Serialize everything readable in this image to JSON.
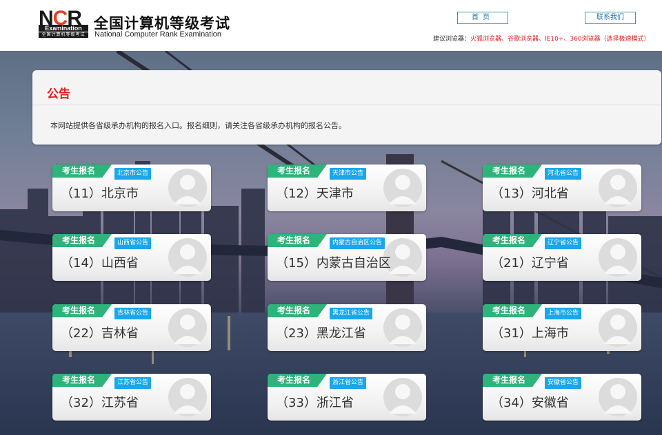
{
  "header": {
    "logo_letters": "NCR",
    "logo_word": "Examination",
    "logo_sub": "全国计算机等级考试",
    "title": "全国计算机等级考试",
    "subtitle": "National Computer Rank Examination",
    "home_label": "首页",
    "contact_label": "联系我们",
    "browser_tip_prefix": "建议浏览器：",
    "browser_tip_list": "火狐浏览器、谷歌浏览器、IE10+、360浏览器（选择极速模式）"
  },
  "notice": {
    "title": "公告",
    "text": "本网站提供各省级承办机构的报名入口。报名细则，请关注各省级承办机构的报名公告。"
  },
  "card_tag_label": "考生报名",
  "colors": {
    "tag_green": "#2eb37a",
    "badge_blue": "#19a7ec",
    "notice_red": "#e01e1e"
  },
  "provinces": [
    {
      "name": "（11）北京市",
      "badge": "北京市公告"
    },
    {
      "name": "（12）天津市",
      "badge": "天津市公告"
    },
    {
      "name": "（13）河北省",
      "badge": "河北省公告"
    },
    {
      "name": "（14）山西省",
      "badge": "山西省公告"
    },
    {
      "name": "（15）内蒙古自治区",
      "badge": "内蒙古自治区公告"
    },
    {
      "name": "（21）辽宁省",
      "badge": "辽宁省公告"
    },
    {
      "name": "（22）吉林省",
      "badge": "吉林省公告"
    },
    {
      "name": "（23）黑龙江省",
      "badge": "黑龙江省公告"
    },
    {
      "name": "（31）上海市",
      "badge": "上海市公告"
    },
    {
      "name": "（32）江苏省",
      "badge": "江苏省公告"
    },
    {
      "name": "（33）浙江省",
      "badge": "浙江省公告"
    },
    {
      "name": "（34）安徽省",
      "badge": "安徽省公告"
    }
  ]
}
